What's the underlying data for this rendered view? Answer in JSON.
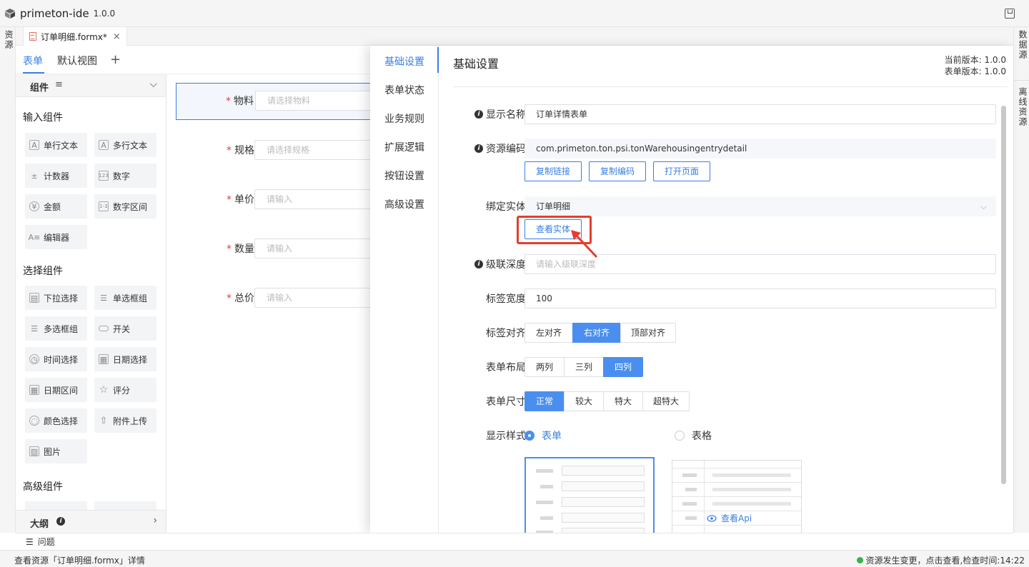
{
  "app": {
    "title": "primeton-ide",
    "version": "1.0.0"
  },
  "left_strip": {
    "label": "资源"
  },
  "right_strip": {
    "label1": "数据源",
    "label2": "离线资源"
  },
  "editor_tab": {
    "name": "订单明细.formx*"
  },
  "form_tabs": {
    "tab1": "表单",
    "tab2": "默认视图",
    "add": "+"
  },
  "components": {
    "header": "组件",
    "groups": {
      "input": "输入组件",
      "select": "选择组件",
      "advanced": "高级组件"
    },
    "input_items": [
      "单行文本",
      "多行文本",
      "计数器",
      "数字",
      "金额",
      "数字区间",
      "编辑器"
    ],
    "select_items": [
      "下拉选择",
      "单选框组",
      "多选框组",
      "开关",
      "时间选择",
      "日期选择",
      "日期区间",
      "评分",
      "颜色选择",
      "附件上传",
      "图片"
    ]
  },
  "outline": {
    "label": "大纲"
  },
  "canvas_fields": [
    {
      "label": "物料",
      "placeholder": "请选择物料"
    },
    {
      "label": "规格",
      "placeholder": "请选择规格"
    },
    {
      "label": "单价",
      "placeholder": "请输入"
    },
    {
      "label": "数量",
      "placeholder": "请输入"
    },
    {
      "label": "总价",
      "placeholder": "请输入"
    }
  ],
  "settings_nav": [
    "基础设置",
    "表单状态",
    "业务规则",
    "扩展逻辑",
    "按钮设置",
    "高级设置"
  ],
  "settings": {
    "title": "基础设置",
    "current_version": "当前版本: 1.0.0",
    "form_version": "表单版本: 1.0.0",
    "display_name_label": "显示名称",
    "display_name_value": "订单详情表单",
    "resource_code_label": "资源编码",
    "resource_code_value": "com.primeton.ton.psi.tonWarehousingentrydetail",
    "btn_copy_link": "复制链接",
    "btn_copy_code": "复制编码",
    "btn_open_page": "打开页面",
    "bind_entity_label": "绑定实体",
    "bind_entity_value": "订单明细",
    "btn_view_entity": "查看实体",
    "cascade_label": "级联深度",
    "cascade_placeholder": "请输入级联深度",
    "label_width_label": "标签宽度",
    "label_width_value": "100",
    "label_align_label": "标签对齐",
    "label_align_options": [
      "左对齐",
      "右对齐",
      "顶部对齐"
    ],
    "layout_label": "表单布局",
    "layout_options": [
      "两列",
      "三列",
      "四列"
    ],
    "size_label": "表单尺寸",
    "size_options": [
      "正常",
      "较大",
      "特大",
      "超特大"
    ],
    "style_label": "显示样式",
    "style_form": "表单",
    "style_table": "表格",
    "view_api": "查看Api"
  },
  "problems": {
    "label": "问题"
  },
  "status": {
    "left": "查看资源「订单明细.formx」详情",
    "right": "资源发生变更，点击查看,检查时间:14:22"
  },
  "colors": {
    "accent": "#3a7fe3",
    "annotation": "#e53d2f",
    "status_ok": "#35b44a"
  }
}
